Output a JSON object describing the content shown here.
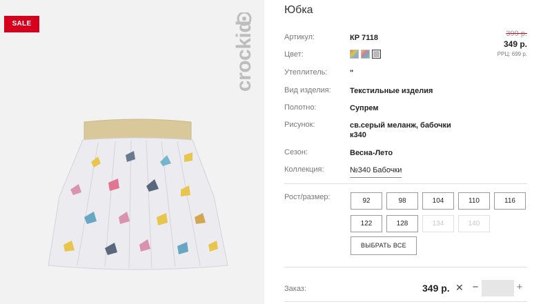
{
  "badge": {
    "sale": "SALE"
  },
  "brand": {
    "logo_text": "crockid"
  },
  "product": {
    "title": "Юбка",
    "fields": [
      {
        "label": "Артикул:",
        "value": "КР 7118"
      },
      {
        "label": "Цвет:",
        "value": ""
      },
      {
        "label": "Утеплитель:",
        "value": "\""
      },
      {
        "label": "Вид изделия:",
        "value": "Текстильные изделия"
      },
      {
        "label": "Полотно:",
        "value": "Супрем"
      },
      {
        "label": "Рисунок:",
        "value": "св.серый меланж, бабочки",
        "value2": "к340"
      },
      {
        "label": "Сезон:",
        "value": "Весна-Лето"
      },
      {
        "label": "Коллекция:",
        "value": "№340 Бабочки"
      }
    ],
    "swatch_colors": [
      "#d88a5a",
      "#7fb8c8",
      "#b9b9b9"
    ]
  },
  "price": {
    "old": "399 р.",
    "new": "349 р.",
    "rrp": "РРЦ: 699 р."
  },
  "sizes": {
    "label": "Рост/размер:",
    "options": [
      {
        "label": "92",
        "available": true
      },
      {
        "label": "98",
        "available": true
      },
      {
        "label": "104",
        "available": true
      },
      {
        "label": "110",
        "available": true
      },
      {
        "label": "116",
        "available": true
      },
      {
        "label": "122",
        "available": true
      },
      {
        "label": "128",
        "available": true
      },
      {
        "label": "134",
        "available": false
      },
      {
        "label": "140",
        "available": false
      }
    ],
    "select_all": "ВЫБРАТЬ ВСЕ"
  },
  "order": {
    "label": "Заказ:",
    "price": "349 р.",
    "multiply": "✕",
    "minus": "−",
    "plus": "+",
    "quantity": ""
  },
  "colors": {
    "sale_red": "#d6001c",
    "text": "#222222",
    "label_grey": "#777777"
  }
}
